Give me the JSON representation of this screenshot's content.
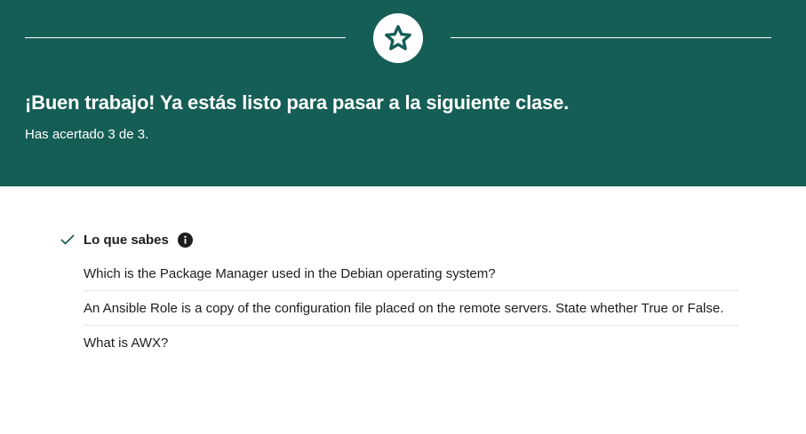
{
  "banner": {
    "background": "#155e55",
    "icon": "star-icon",
    "headline": "¡Buen trabajo! Ya estás listo para pasar a la siguiente clase.",
    "score_text": "Has acertado 3 de 3."
  },
  "results": {
    "section_icon": "check-icon",
    "section_title": "Lo que sabes",
    "info_icon": "info-icon",
    "accent_color": "#1e6055",
    "questions": [
      "Which is the Package Manager used in the Debian operating system?",
      "An Ansible Role is a copy of the configuration file placed on the remote servers. State whether True or False.",
      "What is AWX?"
    ]
  }
}
